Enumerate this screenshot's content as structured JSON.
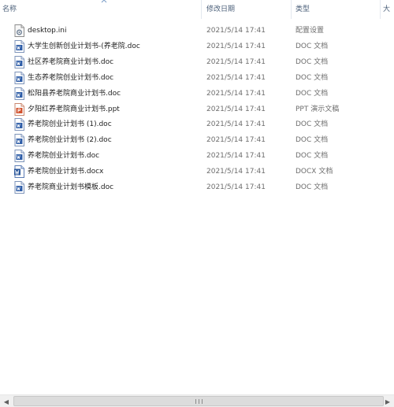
{
  "columns": {
    "name": "名称",
    "date": "修改日期",
    "type": "类型",
    "size": "大小"
  },
  "files": [
    {
      "name": "desktop.ini",
      "date": "2021/5/14 17:41",
      "type": "配置设置",
      "icon": "settings-file-icon"
    },
    {
      "name": "大学生创新创业计划书-(养老院.doc",
      "date": "2021/5/14 17:41",
      "type": "DOC 文档",
      "icon": "doc-file-icon"
    },
    {
      "name": "社区养老院商业计划书.doc",
      "date": "2021/5/14 17:41",
      "type": "DOC 文档",
      "icon": "doc-file-icon"
    },
    {
      "name": "生态养老院创业计划书.doc",
      "date": "2021/5/14 17:41",
      "type": "DOC 文档",
      "icon": "doc-file-icon"
    },
    {
      "name": "松阳县养老院商业计划书.doc",
      "date": "2021/5/14 17:41",
      "type": "DOC 文档",
      "icon": "doc-file-icon"
    },
    {
      "name": "夕阳红养老院商业计划书.ppt",
      "date": "2021/5/14 17:41",
      "type": "PPT 演示文稿",
      "icon": "ppt-file-icon"
    },
    {
      "name": "养老院创业计划书 (1).doc",
      "date": "2021/5/14 17:41",
      "type": "DOC 文档",
      "icon": "doc-file-icon"
    },
    {
      "name": "养老院创业计划书 (2).doc",
      "date": "2021/5/14 17:41",
      "type": "DOC 文档",
      "icon": "doc-file-icon"
    },
    {
      "name": "养老院创业计划书.doc",
      "date": "2021/5/14 17:41",
      "type": "DOC 文档",
      "icon": "doc-file-icon"
    },
    {
      "name": "养老院创业计划书.docx",
      "date": "2021/5/14 17:41",
      "type": "DOCX 文档",
      "icon": "docx-file-icon"
    },
    {
      "name": "养老院商业计划书模板.doc",
      "date": "2021/5/14 17:41",
      "type": "DOC 文档",
      "icon": "doc-file-icon"
    }
  ],
  "scrollbar": {
    "left_arrow": "◀",
    "right_arrow": "▶"
  },
  "colors": {
    "header_text": "#4c607a",
    "doc_icon": "#2f5ea8",
    "ppt_icon": "#d2522d",
    "docx_icon": "#2b579a"
  }
}
